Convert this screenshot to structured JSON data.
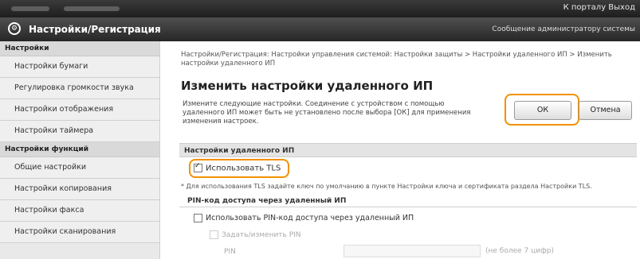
{
  "topbar": {
    "right_links": "К порталу  Выход"
  },
  "header": {
    "logo_glyph": "⚙",
    "title": "Настройки/Регистрация",
    "admin_link": "Сообщение администратору системы"
  },
  "sidebar": {
    "section1_title": "Настройки",
    "section1_items": [
      "Настройки бумаги",
      "Регулировка громкости звука",
      "Настройки отображения",
      "Настройки таймера"
    ],
    "section2_title": "Настройки функций",
    "section2_items": [
      "Общие настройки",
      "Настройки копирования",
      "Настройки факса",
      "Настройки сканирования"
    ]
  },
  "main": {
    "breadcrumb": "Настройки/Регистрация: Настройки управления системой: Настройки защиты > Настройки удаленного ИП > Изменить настройки удаленного ИП",
    "page_title": "Изменить настройки удаленного ИП",
    "description": "Измените следующие настройки. Соединение с устройством с помощью удаленного ИП может быть не установлено после выбора [ОК] для применения изменения настроек.",
    "ok_label": "ОК",
    "cancel_label": "Отмена",
    "section_title": "Настройки удаленного ИП",
    "use_tls_label": "Использовать TLS",
    "use_tls_checked": true,
    "tls_note": "* Для использования TLS задайте ключ по умолчанию в пункте Настройки ключа и сертификата раздела Настройки TLS.",
    "pin_section_title": "PIN-код доступа через удаленный ИП",
    "pin_use_label": "Использовать PIN-код доступа через удаленный ИП",
    "pin_set_label": "Задать/изменить PIN",
    "pin_field_label": "PIN",
    "pin_hint": "(не более 7 цифр)"
  },
  "colors": {
    "highlight": "#f29100"
  }
}
